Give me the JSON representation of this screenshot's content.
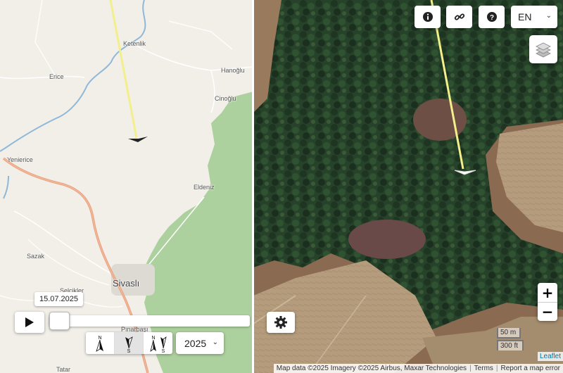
{
  "left_map": {
    "places": {
      "ketenlik": "Ketenlik",
      "erice": "Erice",
      "hanoglu": "Hanoğlu",
      "cinoglu": "Cinoğlu",
      "yenierice": "Yenierice",
      "eldeniz": "Eldeniz",
      "sazak": "Sazak",
      "sivasli": "Sivaslı",
      "pinarbasi": "Pınarbaşı",
      "tatar": "Tatar",
      "selcikler": "Selcikler"
    }
  },
  "timeline": {
    "date_label": "15.07.2025",
    "progress": 0.0,
    "year_value": "2025",
    "orientation": {
      "north_up_label": "N",
      "south_up_label": "S",
      "split_labels": [
        "N",
        "S"
      ]
    }
  },
  "controls": {
    "info_icon": "info-icon",
    "link_icon": "link-icon",
    "help_icon": "help-icon",
    "language": "EN",
    "layers_icon": "layers-icon",
    "settings_icon": "gear-icon",
    "zoom_in": "+",
    "zoom_out": "−"
  },
  "scale": {
    "metric": "50 m",
    "imperial": "300 ft"
  },
  "attribution": {
    "leaflet": "Leaflet",
    "text": "Map data ©2025 Imagery ©2025 Airbus, Maxar Technologies",
    "terms": "Terms",
    "report": "Report a map error"
  },
  "colors": {
    "track": "#f3ef8a",
    "forest": "#aad3a0",
    "road": "#e89a78"
  }
}
